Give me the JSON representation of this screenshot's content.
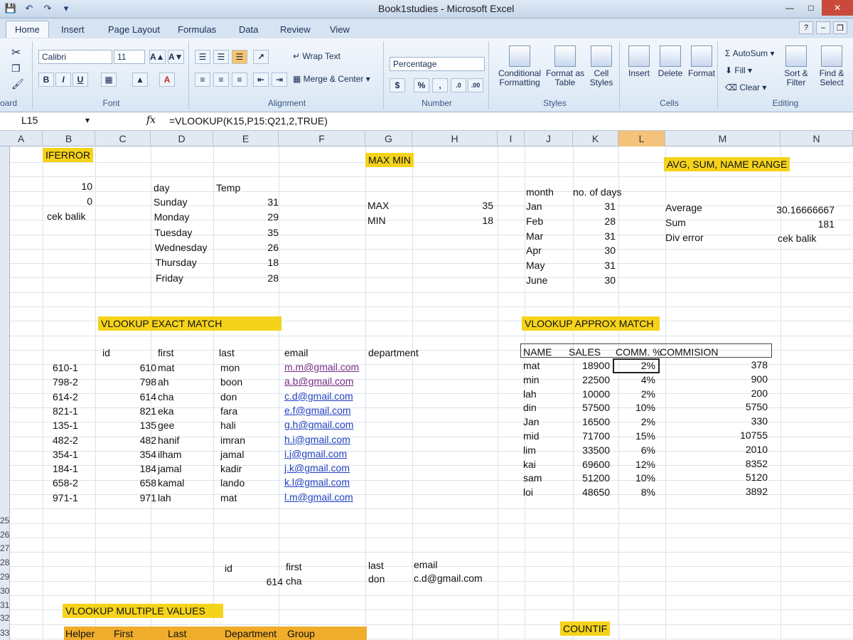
{
  "window": {
    "title": "Book1studies - Microsoft Excel"
  },
  "tabs": [
    "Home",
    "Insert",
    "Page Layout",
    "Formulas",
    "Data",
    "Review",
    "View"
  ],
  "ribbon": {
    "clipboard_label": "oard",
    "font_group_label": "Font",
    "font_name": "Calibri",
    "font_size": "11",
    "alignment_label": "Alignment",
    "wrap_text": "Wrap Text",
    "merge_center": "Merge & Center",
    "number_label": "Number",
    "number_format": "Percentage",
    "styles_label": "Styles",
    "conditional_formatting": "Conditional Formatting",
    "format_as_table": "Format as Table",
    "cell_styles": "Cell Styles",
    "cells_label": "Cells",
    "insert": "Insert",
    "delete": "Delete",
    "format": "Format",
    "editing_label": "Editing",
    "autosum": "AutoSum",
    "fill": "Fill",
    "clear": "Clear",
    "sort_filter": "Sort & Filter",
    "find_select": "Find & Select"
  },
  "formula_bar": {
    "name_box": "L15",
    "fx": "fx",
    "formula": "=VLOOKUP(K15,P15:Q21,2,TRUE)"
  },
  "columns": [
    "A",
    "B",
    "C",
    "D",
    "E",
    "F",
    "G",
    "H",
    "I",
    "J",
    "K",
    "L",
    "M",
    "N"
  ],
  "row_numbers": [
    "25",
    "26",
    "27",
    "28",
    "29",
    "30",
    "31",
    "32",
    "33"
  ],
  "sections": {
    "iferror": "IFERROR",
    "maxmin": "MAX MIN",
    "avgsum": "AVG, SUM, NAME RANGE",
    "vlookup_exact": "VLOOKUP    EXACT MATCH",
    "vlookup_approx": "VLOOKUP APPROX MATCH",
    "vlookup_multi": "VLOOKUP MULTIPLE    VALUES",
    "countif": "COUNTIF"
  },
  "iferror": {
    "v1": "10",
    "v2": "0",
    "v3": "cek balik"
  },
  "temps": {
    "h_day": "day",
    "h_temp": "Temp",
    "rows": [
      {
        "day": "Sunday",
        "temp": "31"
      },
      {
        "day": "Monday",
        "temp": "29"
      },
      {
        "day": "Tuesday",
        "temp": "35"
      },
      {
        "day": "Wednesday",
        "temp": "26"
      },
      {
        "day": "Thursday",
        "temp": "18"
      },
      {
        "day": "Friday",
        "temp": "28"
      }
    ]
  },
  "maxmin": {
    "max_label": "MAX",
    "max_val": "35",
    "min_label": "MIN",
    "min_val": "18"
  },
  "months": {
    "h_month": "month",
    "h_days": "no. of days",
    "rows": [
      {
        "m": "Jan",
        "d": "31"
      },
      {
        "m": "Feb",
        "d": "28"
      },
      {
        "m": "Mar",
        "d": "31"
      },
      {
        "m": "Apr",
        "d": "30"
      },
      {
        "m": "May",
        "d": "31"
      },
      {
        "m": "June",
        "d": "30"
      }
    ]
  },
  "avg": {
    "avg_label": "Average",
    "avg_val": "30.16666667",
    "sum_label": "Sum",
    "sum_val": "181",
    "div_label": "Div error",
    "div_val": "cek balik"
  },
  "exact": {
    "h_id": "id",
    "h_first": "first",
    "h_last": "last",
    "h_email": "email",
    "h_dept": "department",
    "rows": [
      {
        "key": "610-1",
        "id": "610",
        "first": "mat",
        "last": "mon",
        "email": "m.m@gmail.com"
      },
      {
        "key": "798-2",
        "id": "798",
        "first": "ah",
        "last": "boon",
        "email": "a.b@gmail.com"
      },
      {
        "key": "614-2",
        "id": "614",
        "first": "cha",
        "last": "don",
        "email": "c.d@gmail.com"
      },
      {
        "key": "821-1",
        "id": "821",
        "first": "eka",
        "last": "fara",
        "email": "e.f@gmail.com"
      },
      {
        "key": "135-1",
        "id": "135",
        "first": "gee",
        "last": "hali",
        "email": "g.h@gmail.com"
      },
      {
        "key": "482-2",
        "id": "482",
        "first": "hanif",
        "last": "imran",
        "email": "h.i@gmail.com"
      },
      {
        "key": "354-1",
        "id": "354",
        "first": "ilham",
        "last": "jamal",
        "email": "i.j@gmail.com"
      },
      {
        "key": "184-1",
        "id": "184",
        "first": "jamal",
        "last": "kadir",
        "email": "j.k@gmail.com"
      },
      {
        "key": "658-2",
        "id": "658",
        "first": "kamal",
        "last": "lando",
        "email": "k.l@gmail.com"
      },
      {
        "key": "971-1",
        "id": "971",
        "first": "lah",
        "last": "mat",
        "email": "l.m@gmail.com"
      }
    ]
  },
  "approx": {
    "h_name": "NAME",
    "h_sales": "SALES",
    "h_comm": "COMM. %",
    "h_commision": "COMMISION",
    "rows": [
      {
        "name": "mat",
        "sales": "18900",
        "comm": "2%",
        "c": "378"
      },
      {
        "name": "min",
        "sales": "22500",
        "comm": "4%",
        "c": "900"
      },
      {
        "name": "lah",
        "sales": "10000",
        "comm": "2%",
        "c": "200"
      },
      {
        "name": "din",
        "sales": "57500",
        "comm": "10%",
        "c": "5750"
      },
      {
        "name": "Jan",
        "sales": "16500",
        "comm": "2%",
        "c": "330"
      },
      {
        "name": "mid",
        "sales": "71700",
        "comm": "15%",
        "c": "10755"
      },
      {
        "name": "lim",
        "sales": "33500",
        "comm": "6%",
        "c": "2010"
      },
      {
        "name": "kai",
        "sales": "69600",
        "comm": "12%",
        "c": "8352"
      },
      {
        "name": "sam",
        "sales": "51200",
        "comm": "10%",
        "c": "5120"
      },
      {
        "name": "loi",
        "sales": "48650",
        "comm": "8%",
        "c": "3892"
      }
    ]
  },
  "lookup_result": {
    "h_id": "id",
    "h_first": "first",
    "h_last": "last",
    "h_email": "email",
    "id": "614",
    "first": "cha",
    "last": "don",
    "email": "c.d@gmail.com"
  },
  "multi": {
    "h_helper": "Helper",
    "h_first": "First",
    "h_last": "Last",
    "h_dept": "Department",
    "h_group": "Group"
  }
}
